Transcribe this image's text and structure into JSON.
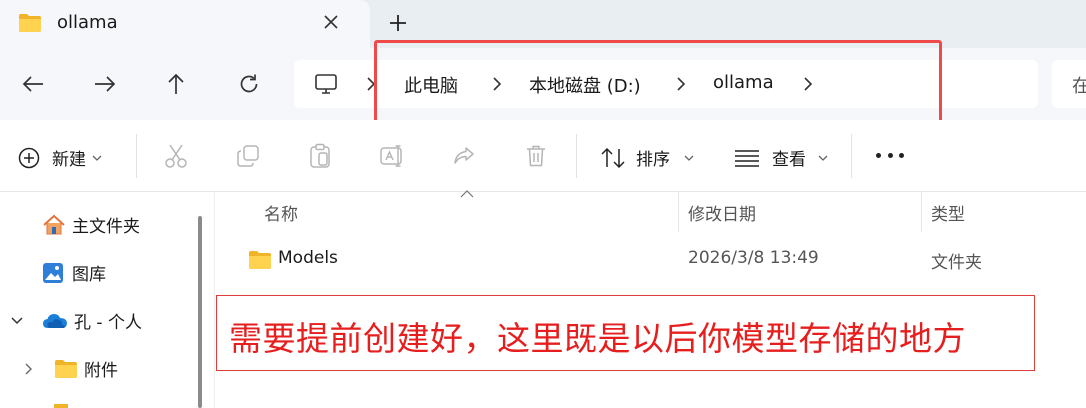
{
  "tab": {
    "title": "ollama"
  },
  "breadcrumbs": [
    "此电脑",
    "本地磁盘 (D:)",
    "ollama"
  ],
  "search": {
    "placeholder": "在"
  },
  "commands": {
    "new_label": "新建",
    "sort_label": "排序",
    "view_label": "查看"
  },
  "sidebar": {
    "items": [
      {
        "label": "主文件夹"
      },
      {
        "label": "图库"
      },
      {
        "label": "孔 - 个人"
      },
      {
        "label": "附件"
      }
    ]
  },
  "columns": {
    "name": "名称",
    "modified": "修改日期",
    "type": "类型"
  },
  "files": [
    {
      "name": "Models",
      "modified": "2026/3/8 13:49",
      "type": "文件夹"
    }
  ],
  "annotation": {
    "text": "需要提前创建好，这里既是以后你模型存储的地方"
  },
  "colors": {
    "accent_red": "#e61e1e",
    "folder_yellow": "#f7c948",
    "onedrive_blue": "#1b7fd8"
  }
}
